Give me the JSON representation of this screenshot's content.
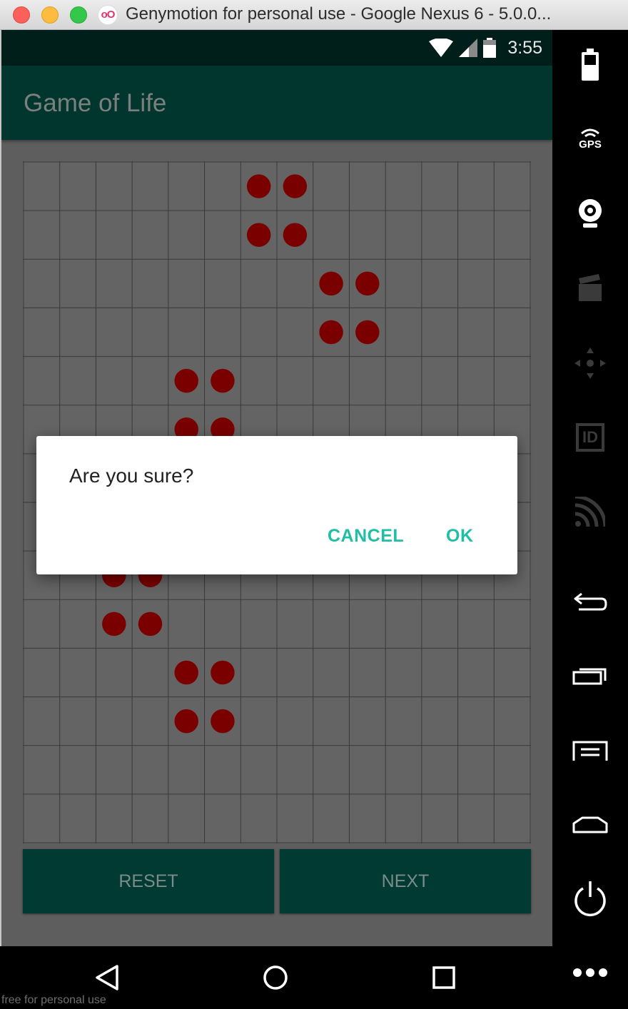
{
  "window": {
    "title": "Genymotion for personal use - Google Nexus 6 - 5.0.0...",
    "logo_text": "oO",
    "watermark": "free for personal use"
  },
  "status_bar": {
    "time": "3:55"
  },
  "app": {
    "title": "Game of Life",
    "grid": {
      "rows": 14,
      "cols": 14,
      "live_cells": [
        [
          0,
          6
        ],
        [
          0,
          7
        ],
        [
          1,
          6
        ],
        [
          1,
          7
        ],
        [
          2,
          8
        ],
        [
          2,
          9
        ],
        [
          3,
          8
        ],
        [
          3,
          9
        ],
        [
          4,
          4
        ],
        [
          4,
          5
        ],
        [
          5,
          4
        ],
        [
          5,
          5
        ],
        [
          8,
          2
        ],
        [
          8,
          3
        ],
        [
          9,
          2
        ],
        [
          9,
          3
        ],
        [
          10,
          4
        ],
        [
          10,
          5
        ],
        [
          11,
          4
        ],
        [
          11,
          5
        ]
      ],
      "cell_color": "#7a0000",
      "line_color": "#3a3a3a"
    },
    "buttons": {
      "reset": "RESET",
      "next": "NEXT"
    }
  },
  "dialog": {
    "message": "Are you sure?",
    "cancel": "CANCEL",
    "ok": "OK"
  },
  "side_toolbar": {
    "gps_label": "GPS",
    "id_label": "ID",
    "tools": [
      "battery-icon",
      "gps-icon",
      "webcam-icon",
      "screencast-icon",
      "dpad-icon",
      "device-id-icon",
      "network-icon",
      "back-icon",
      "recent-apps-icon",
      "menu-icon",
      "home-icon",
      "power-icon",
      "more-icon"
    ]
  },
  "colors": {
    "accent": "#1fbfa6",
    "app_bar": "#00362e",
    "status_bar": "#001e1a",
    "button_bg": "#003a33"
  }
}
